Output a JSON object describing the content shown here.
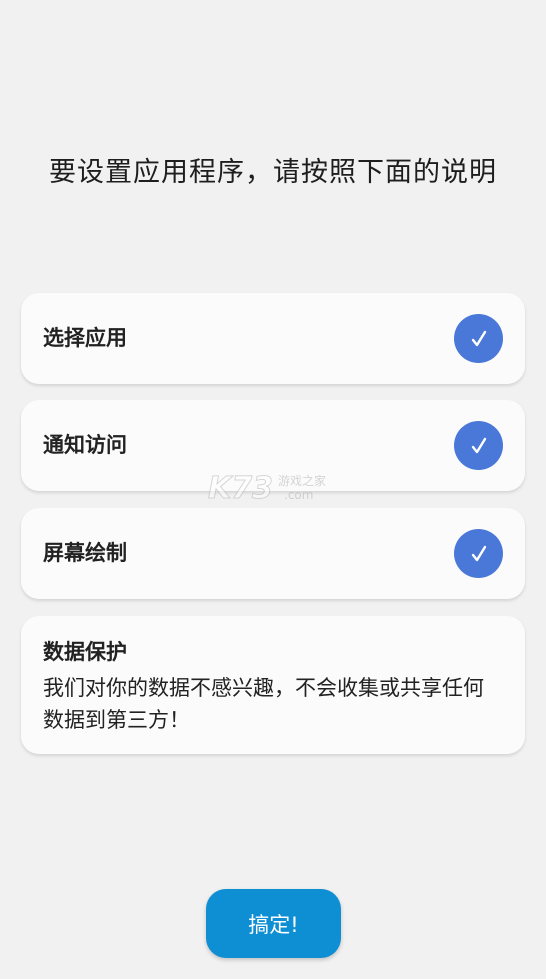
{
  "title": "要设置应用程序，请按照下面的说明",
  "steps": [
    {
      "label": "选择应用",
      "checked": true
    },
    {
      "label": "通知访问",
      "checked": true
    },
    {
      "label": "屏幕绘制",
      "checked": true
    }
  ],
  "privacy": {
    "title": "数据保护",
    "text": "我们对你的数据不感兴趣，不会收集或共享任何数据到第三方！"
  },
  "done_button": "搞定!",
  "watermark": {
    "brand": "K73",
    "tagline": "游戏之家",
    "domain": ".com"
  },
  "colors": {
    "background": "#f1f1f1",
    "card": "#fbfbfb",
    "check_accent": "#4a78d8",
    "button": "#0e8ed3"
  },
  "icons": {
    "step_status": "checkmark-icon"
  }
}
